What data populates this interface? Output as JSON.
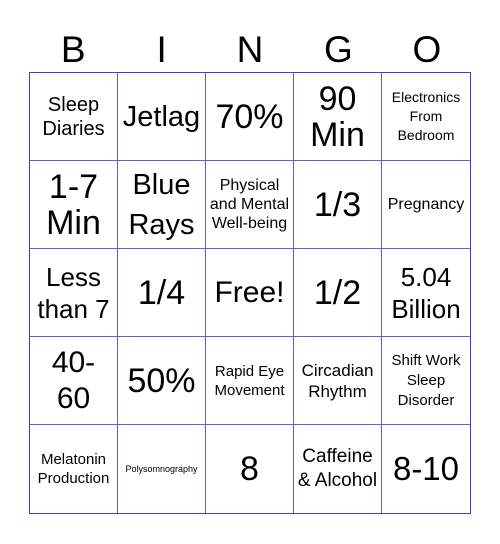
{
  "header": [
    "B",
    "I",
    "N",
    "G",
    "O"
  ],
  "colors": {
    "grid_line": "#4a3ad0",
    "text": "#000000",
    "background": "#ffffff"
  },
  "cells": [
    [
      "Sleep Diaries",
      "Jetlag",
      "70%",
      "90 Min",
      "Electronics From Bedroom"
    ],
    [
      "1-7 Min",
      "Blue Rays",
      "Physical and Mental Well-being",
      "1/3",
      "Pregnancy"
    ],
    [
      "Less than 7",
      "1/4",
      "Free!",
      "1/2",
      "5.04 Billion"
    ],
    [
      "40-60",
      "50%",
      "Rapid Eye Movement",
      "Circadian Rhythm",
      "Shift Work Sleep Disorder"
    ],
    [
      "Melatonin Production",
      "Polysomnography",
      "8",
      "Caffeine & Alcohol",
      "8-10"
    ]
  ]
}
